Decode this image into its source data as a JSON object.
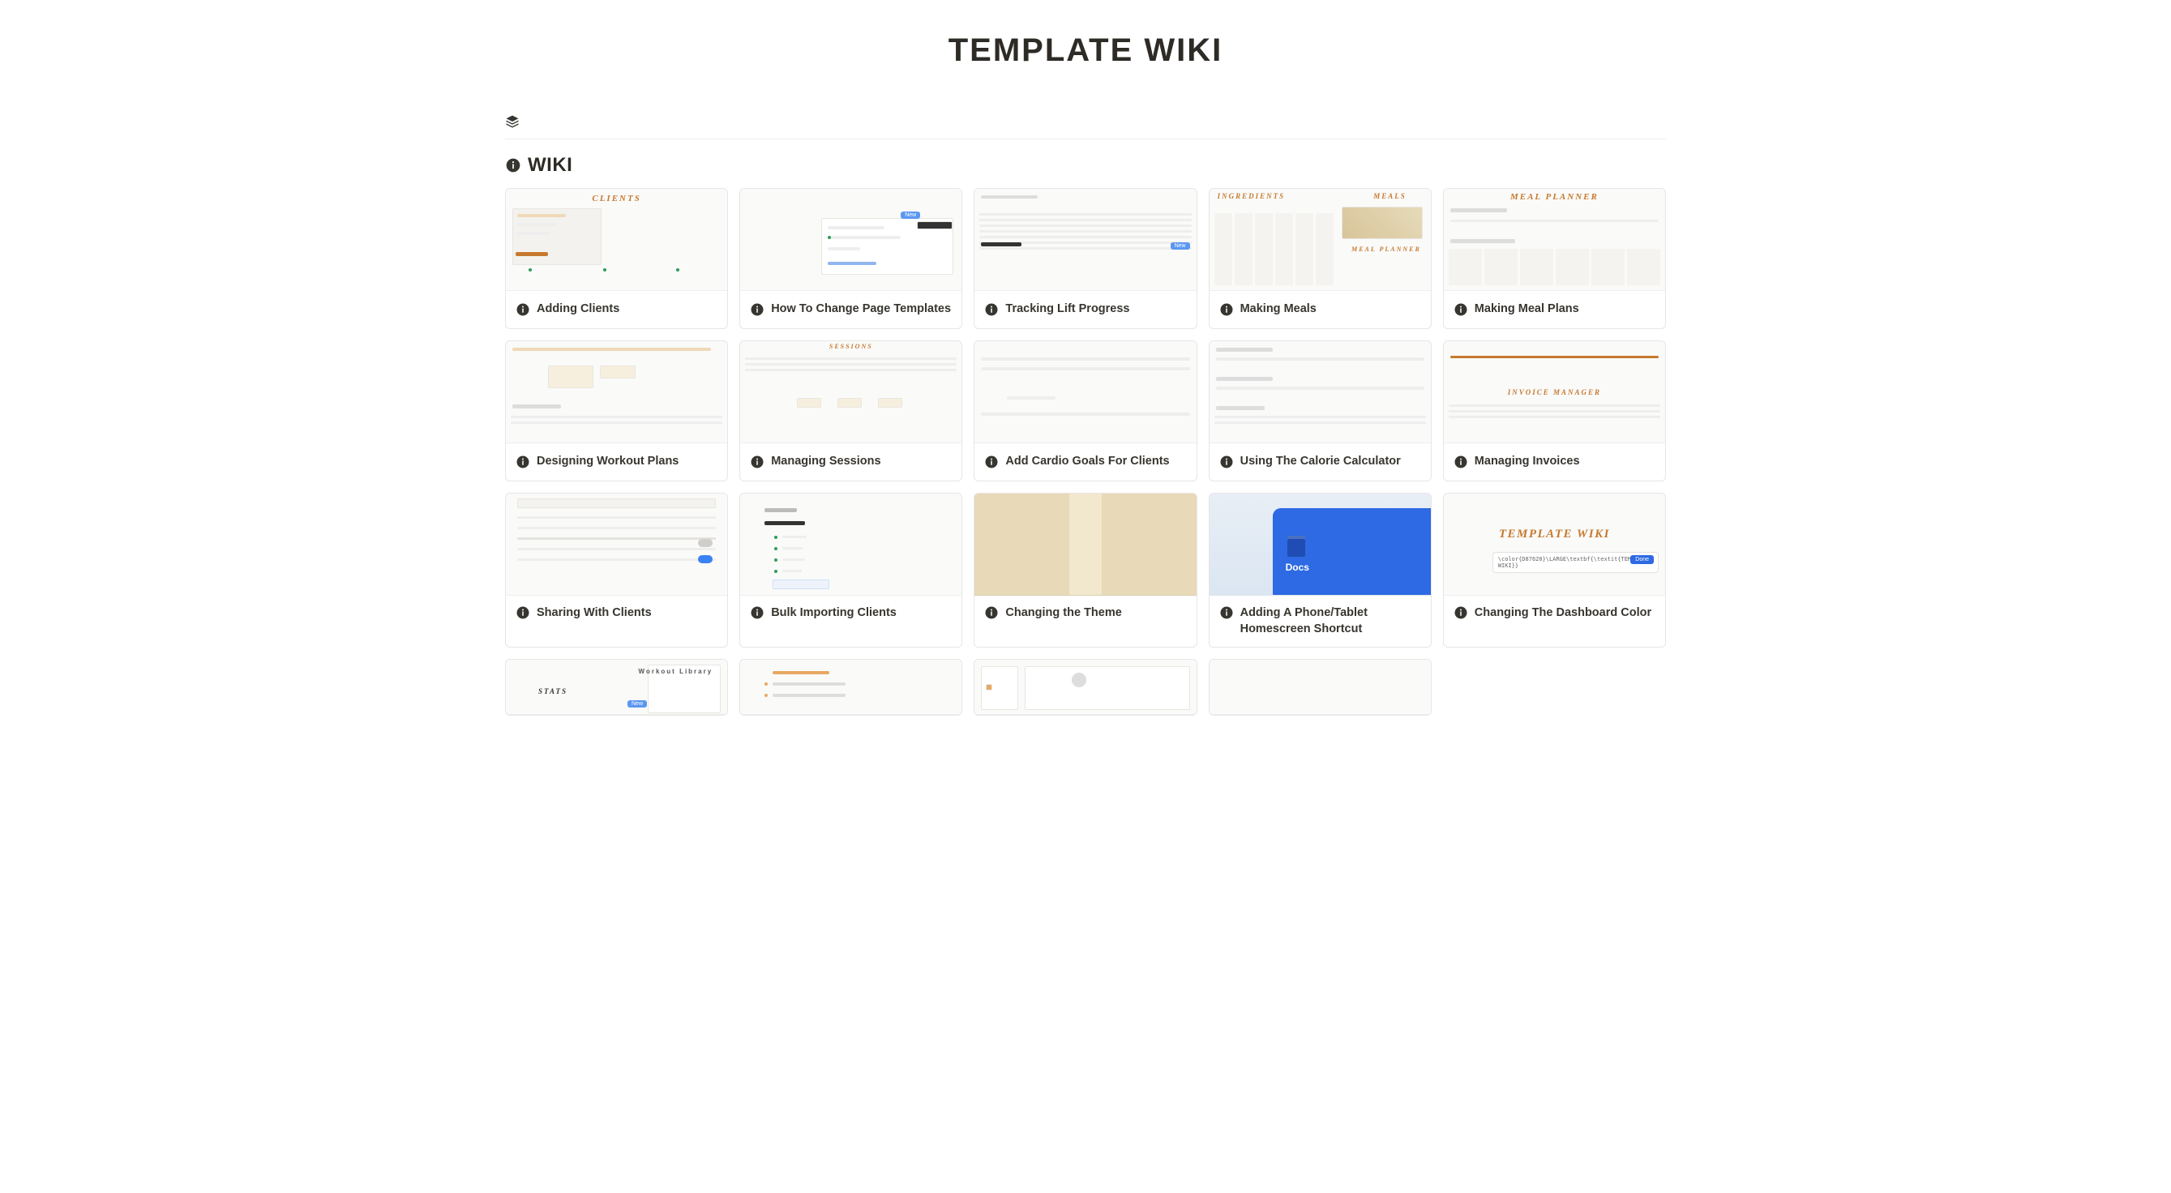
{
  "page": {
    "title": "TEMPLATE WIKI"
  },
  "section": {
    "title": "WIKI"
  },
  "colors": {
    "accent_orange": "#c7792e",
    "link_blue": "#2d6ae3"
  },
  "thumb_text": {
    "clients": "CLIENTS",
    "ingredients": "INGREDIENTS",
    "meals": "MEALS",
    "meal_planner": "MEAL PLANNER",
    "meal_planner2": "MEAL PLANNER",
    "sessions": "SESSIONS",
    "invoice": "INVOICE MANAGER",
    "docs": "Docs",
    "tw_title": "TEMPLATE WIKI",
    "tw_code": "\\color{D87620}\\LARGE\\textbf{\\textit{TEMPLATE WIKI}}",
    "tw_done": "Done",
    "new_btn": "New",
    "stats": "STATS",
    "workout_library": "Workout Library"
  },
  "cards": [
    {
      "title": "Adding Clients"
    },
    {
      "title": "How To Change Page Templates"
    },
    {
      "title": "Tracking Lift Progress"
    },
    {
      "title": "Making Meals"
    },
    {
      "title": "Making Meal Plans"
    },
    {
      "title": "Designing Workout Plans"
    },
    {
      "title": "Managing Sessions"
    },
    {
      "title": "Add Cardio Goals For Clients"
    },
    {
      "title": "Using The Calorie Calculator"
    },
    {
      "title": "Managing Invoices"
    },
    {
      "title": "Sharing With Clients"
    },
    {
      "title": "Bulk Importing Clients"
    },
    {
      "title": "Changing the Theme"
    },
    {
      "title": "Adding A Phone/Tablet Homescreen Shortcut"
    },
    {
      "title": "Changing The Dashboard Color"
    }
  ]
}
